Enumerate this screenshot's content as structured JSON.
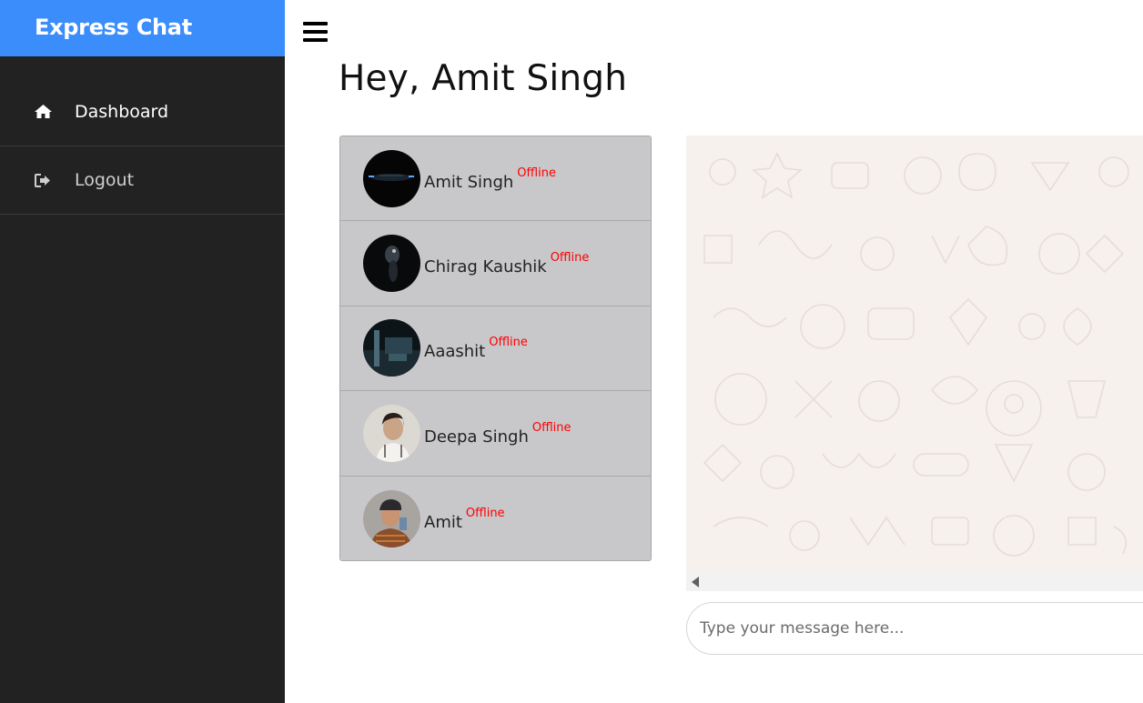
{
  "app": {
    "brand": "Express Chat"
  },
  "sidebar": {
    "items": [
      {
        "label": "Dashboard",
        "icon": "home-icon",
        "active": true
      },
      {
        "label": "Logout",
        "icon": "logout-icon",
        "active": false
      }
    ]
  },
  "main": {
    "greeting": "Hey, Amit Singh"
  },
  "users": [
    {
      "name": "Amit Singh",
      "status": "Offline"
    },
    {
      "name": "Chirag Kaushik",
      "status": "Offline"
    },
    {
      "name": "Aaashit",
      "status": "Offline"
    },
    {
      "name": "Deepa Singh",
      "status": "Offline"
    },
    {
      "name": "Amit",
      "status": "Offline"
    }
  ],
  "chat": {
    "placeholder": "Type your message here..."
  },
  "colors": {
    "brand": "#3a8dfb",
    "sidebar": "#222222",
    "offline": "#ff0000",
    "list_bg": "#c8c8cb"
  }
}
